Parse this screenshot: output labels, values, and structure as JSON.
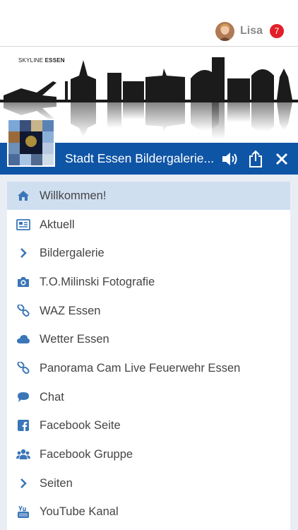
{
  "user": {
    "name": "Lisa",
    "notifications": "7"
  },
  "banner": {
    "title_light": "SKYLINE ",
    "title_bold": "ESSEN"
  },
  "header": {
    "title": "Stadt Essen Bildergalerie..."
  },
  "menu": {
    "items": [
      {
        "label": "Willkommen!",
        "icon": "home-icon",
        "active": true
      },
      {
        "label": "Aktuell",
        "icon": "newspaper-icon"
      },
      {
        "label": "Bildergalerie",
        "icon": "chevron-right-icon"
      },
      {
        "label": "T.O.Milinski Fotografie",
        "icon": "camera-icon"
      },
      {
        "label": "WAZ Essen",
        "icon": "link-icon"
      },
      {
        "label": "Wetter Essen",
        "icon": "cloud-icon"
      },
      {
        "label": "Panorama Cam Live Feuerwehr Essen",
        "icon": "link-icon"
      },
      {
        "label": "Chat",
        "icon": "chat-icon"
      },
      {
        "label": "Facebook Seite",
        "icon": "facebook-icon"
      },
      {
        "label": "Facebook Gruppe",
        "icon": "group-icon"
      },
      {
        "label": "Seiten",
        "icon": "chevron-right-icon"
      },
      {
        "label": "YouTube Kanal",
        "icon": "youtube-icon"
      }
    ]
  },
  "colors": {
    "header_blue": "#0f55a6",
    "icon_blue": "#3a76b8",
    "active_row": "#cfdff0",
    "badge_red": "#e2202a"
  }
}
